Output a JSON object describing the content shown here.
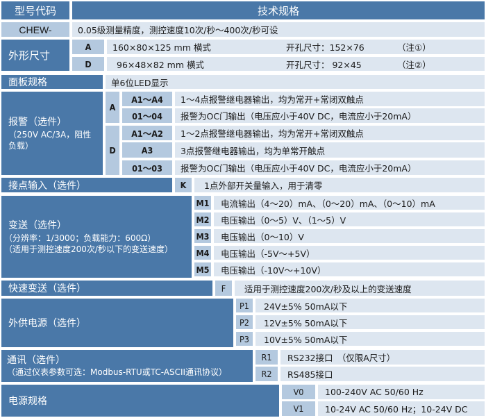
{
  "header": {
    "col1": "型号代码",
    "col2": "技术规格"
  },
  "model": {
    "code": "CHEW-",
    "spec": "0.05级测量精度，测控速度10次/秒～400次/秒可设"
  },
  "dimensions": {
    "label": "外形尺寸",
    "rows": [
      {
        "code": "A",
        "size": "160×80×125 mm 横式",
        "cutout": "开孔尺寸：152×76",
        "note": "（注①）"
      },
      {
        "code": "D",
        "size": "96×48×82 mm 横式",
        "cutout": "开孔尺寸： 92×45",
        "note": "（注②）"
      }
    ]
  },
  "panel": {
    "label": "面板规格",
    "spec": "单6位LED显示"
  },
  "alarm": {
    "label": "报警（选件）",
    "sub1": "（250V AC/3A，阻性",
    "sub2": "负载）",
    "groups": [
      {
        "code": "A",
        "rows": [
          {
            "code": "A1～A4",
            "desc": "1～4点报警继电器输出，均为常开+常闭双触点"
          },
          {
            "code": "01～04",
            "desc": "报警为OC门输出（电压应小于40V DC，电流应小于20mA）"
          }
        ]
      },
      {
        "code": "D",
        "rows": [
          {
            "code": "A1～A2",
            "desc": "1～2点报警继电器输出，均为常开+常闭双触点"
          },
          {
            "code": "A3",
            "desc": "3点报警继电器输出，均为单常开触点"
          },
          {
            "code": "01～03",
            "desc": "报警为OC门输出（电压应小于40V DC，电流应小于20mA）"
          }
        ]
      }
    ]
  },
  "contact_input": {
    "label": "接点输入（选件）",
    "code": "K",
    "desc": "1点外部开关量输入，用于清零"
  },
  "transmit": {
    "label": "变送（选件）",
    "sub1": "（分辨率：1/3000；负载能力：600Ω）",
    "sub2": "（适用于测控速度200次/秒以下的变送速度）",
    "rows": [
      {
        "code": "M1",
        "desc": "电流输出（4～20）mA、（0～20）mA、（0～10）mA"
      },
      {
        "code": "M2",
        "desc": "电压输出（0～5）V、（1～5）V"
      },
      {
        "code": "M3",
        "desc": "电压输出（0～10）V"
      },
      {
        "code": "M4",
        "desc": "电压输出（-5V～+5V）"
      },
      {
        "code": "M5",
        "desc": "电压输出（-10V～+10V）"
      }
    ]
  },
  "fast_transmit": {
    "label": "快速变送（选件）",
    "code": "F",
    "desc": "适用于测控速度200次/秒及以上的变送速度"
  },
  "ext_power": {
    "label": "外供电源（选件）",
    "rows": [
      {
        "code": "P1",
        "desc": "24V±5% 50mA以下"
      },
      {
        "code": "P2",
        "desc": "12V±5% 50mA以下"
      },
      {
        "code": "P3",
        "desc": "10V±5% 50mA以下"
      }
    ]
  },
  "comm": {
    "label": "通讯（选件）",
    "sub": "（通过仪表参数可选：Modbus-RTU或TC-ASCII通讯协议）",
    "rows": [
      {
        "code": "R1",
        "desc": "RS232接口　（仅限A尺寸）"
      },
      {
        "code": "R2",
        "desc": "RS485接口"
      }
    ]
  },
  "power": {
    "label": "电源规格",
    "rows": [
      {
        "code": "V0",
        "desc": "100-240V AC 50/60 Hz"
      },
      {
        "code": "V1",
        "desc": "10-24V AC 50/60 Hz；10-24V DC"
      }
    ]
  }
}
